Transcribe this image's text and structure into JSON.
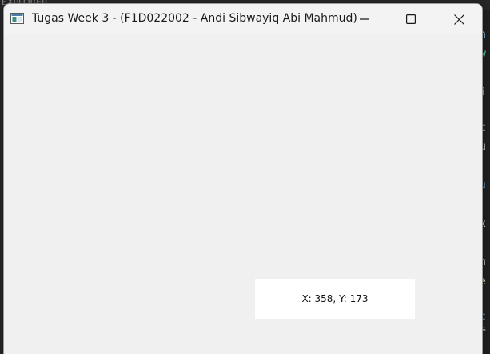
{
  "background": {
    "explorer_label": "EXPLORER",
    "code_fragments": [
      {
        "text": "n",
        "color": "#9cdcfe"
      },
      {
        "text": "w",
        "color": "#4ec9b0"
      },
      {
        "text": "i",
        "color": "#dcdcaa"
      },
      {
        "text": "c",
        "color": "#c586c0"
      },
      {
        "text": "u",
        "color": "#d4d4d4"
      },
      {
        "text": "u",
        "color": "#569cd6"
      },
      {
        "text": "x",
        "color": "#d4d4d4"
      },
      {
        "text": "n",
        "color": "#d4d4d4"
      },
      {
        "text": "e",
        "color": "#dcdcaa"
      },
      {
        "text": "c",
        "color": "#569cd6"
      },
      {
        "text": "=",
        "color": "#d4d4d4"
      }
    ]
  },
  "window": {
    "title": "Tugas Week 3 - (F1D022002 - Andi Sibwayiq Abi Mahmud)",
    "icon": "app-window-icon",
    "controls": {
      "minimize": "minimize-icon",
      "maximize": "maximize-icon",
      "close": "close-icon"
    },
    "client_background": "#f0f0f0"
  },
  "coordinate_label": {
    "text": "X: 358, Y: 173"
  }
}
